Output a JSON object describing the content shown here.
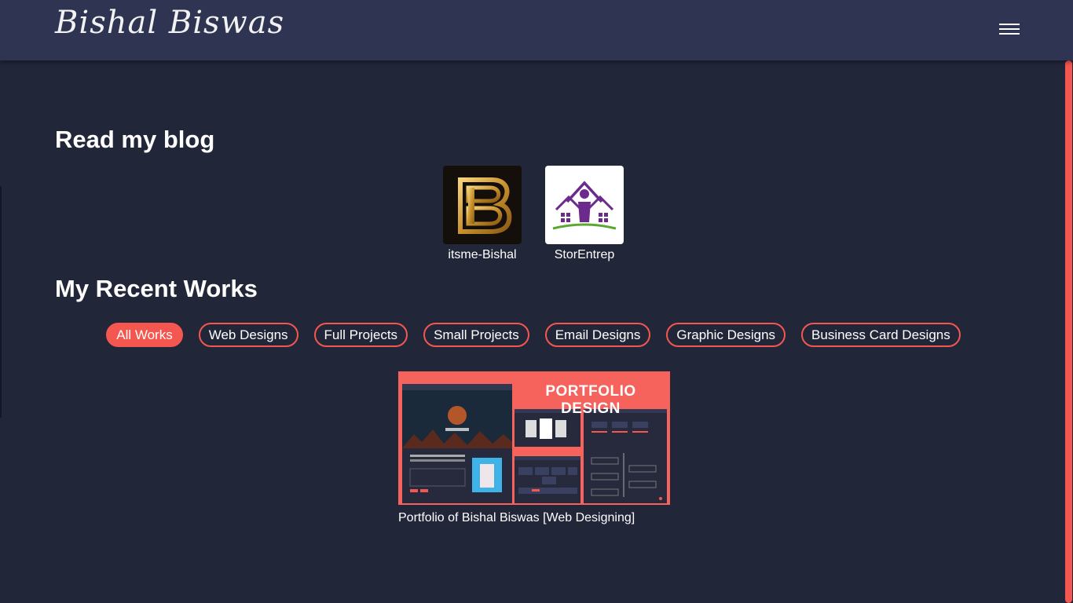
{
  "header": {
    "brand": "Bishal Biswas",
    "menu_icon": "hamburger-menu-icon"
  },
  "blog_section": {
    "title": "Read my blog",
    "blogs": [
      {
        "label": "itsme-Bishal",
        "logo": "b-monogram-logo"
      },
      {
        "label": "StorEntrep",
        "logo": "house-person-logo"
      }
    ]
  },
  "works_section": {
    "title": "My Recent Works",
    "filters": [
      {
        "label": "All Works",
        "active": true
      },
      {
        "label": "Web Designs",
        "active": false
      },
      {
        "label": "Full Projects",
        "active": false
      },
      {
        "label": "Small Projects",
        "active": false
      },
      {
        "label": "Email Designs",
        "active": false
      },
      {
        "label": "Graphic Designs",
        "active": false
      },
      {
        "label": "Business Card Designs",
        "active": false
      }
    ],
    "works": [
      {
        "thumbnail_heading": "PORTFOLIO DESIGN",
        "caption": "Portfolio of Bishal Biswas [Web Designing]"
      }
    ]
  },
  "colors": {
    "background": "#222639",
    "navbar": "#2e3452",
    "accent": "#f4574f"
  }
}
